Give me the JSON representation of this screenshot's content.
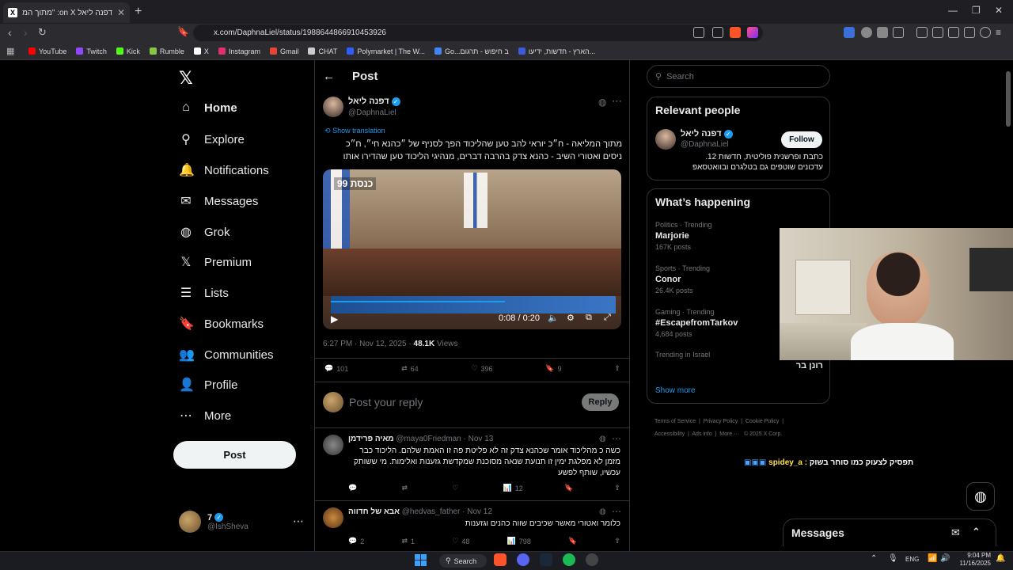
{
  "browser": {
    "tab_title": "דפנה ליאל on X: \"מתוך המלי",
    "tab_icon": "X",
    "url": "x.com/DaphnaLiel/status/1988644866910453926",
    "bookmarks": [
      {
        "label": "YouTube",
        "color": "#ff0000"
      },
      {
        "label": "Twitch",
        "color": "#9146ff"
      },
      {
        "label": "Kick",
        "color": "#53fc18"
      },
      {
        "label": "Rumble",
        "color": "#85c742"
      },
      {
        "label": "X",
        "color": "#ffffff"
      },
      {
        "label": "Instagram",
        "color": "#e1306c"
      },
      {
        "label": "Gmail",
        "color": "#ea4335"
      },
      {
        "label": "CHAT",
        "color": "#cccccc"
      },
      {
        "label": "Polymarket | The W...",
        "color": "#2e5cff"
      },
      {
        "label": "Go...ב חיפוש - תרגום",
        "color": "#4285f4"
      },
      {
        "label": "הארץ - חדשות, ידיעו...",
        "color": "#3b5bdb"
      }
    ]
  },
  "sidebar": {
    "logo": "𝕏",
    "items": [
      {
        "label": "Home",
        "icon": "⌂"
      },
      {
        "label": "Explore",
        "icon": "⚲"
      },
      {
        "label": "Notifications",
        "icon": "🔔"
      },
      {
        "label": "Messages",
        "icon": "✉"
      },
      {
        "label": "Grok",
        "icon": "◍"
      },
      {
        "label": "Premium",
        "icon": "𝕏"
      },
      {
        "label": "Lists",
        "icon": "☰"
      },
      {
        "label": "Bookmarks",
        "icon": "🔖"
      },
      {
        "label": "Communities",
        "icon": "👥"
      },
      {
        "label": "Profile",
        "icon": "👤"
      },
      {
        "label": "More",
        "icon": "⋯"
      }
    ],
    "post_button": "Post",
    "account": {
      "name": "7",
      "handle": "@IshSheva"
    }
  },
  "main": {
    "header": "Post",
    "author": {
      "name": "דפנה ליאל",
      "handle": "@DaphnaLiel"
    },
    "show_translation": "Show translation",
    "tweet_text": "מתוך המליאה - ח״כ יוראי להב טען שהליכוד הפך לסניף של ״כהנא חי״, ח״כ ניסים ואטורי השיב - כהנא צדק בהרבה דברים, מנהיגי  הליכוד טען שהדירו אותו",
    "video": {
      "time": "0:08 / 0:20",
      "overlay_logo": "כנסת 99"
    },
    "timestamp": "6:27 PM · Nov 12, 2025",
    "views_count": "48.1K",
    "views_label": "Views",
    "stats": {
      "replies": "101",
      "reposts": "64",
      "likes": "396",
      "bookmarks": "9"
    },
    "reply_placeholder": "Post your reply",
    "reply_button": "Reply",
    "replies": [
      {
        "name": "מאיה פרידמן",
        "handle": "@maya0Friedman",
        "date": "Nov 13",
        "text": "כשה כ מהליכוד אומר שכהנא צדק  זה לא פליטת פה  זו האמת שלהם. הליכוד כבר מזמן לא מפלגת ימין  זו תנועת שנאה מסוכנת שמקדשת גזענות ואלימות. מי ששותק עכשיו, שותף לפשע",
        "views": "12",
        "replies": "",
        "reposts": "",
        "likes": ""
      },
      {
        "name": "אבא של חדווה",
        "handle": "@hedvas_father",
        "date": "Nov 12",
        "text": "כלומר ואטורי מאשר שכיבים שווה כהנים וגזענות",
        "views": "798",
        "replies": "2",
        "reposts": "1",
        "likes": "48"
      }
    ]
  },
  "right": {
    "search_placeholder": "Search",
    "relevant_title": "Relevant people",
    "relevant_person": {
      "name": "דפנה ליאל",
      "handle": "@DaphnaLiel",
      "bio": "כתבת ופרשנית פוליטית, חדשות 12. עדכונים שוטפים גם בטלגרם ובוואטסאפ",
      "follow": "Follow"
    },
    "happening_title": "What’s happening",
    "trends": [
      {
        "meta": "Politics · Trending",
        "name": "Marjorie",
        "count": "167K posts"
      },
      {
        "meta": "Sports · Trending",
        "name": "Conor",
        "count": "26.4K posts"
      },
      {
        "meta": "Gaming · Trending",
        "name": "#EscapefromTarkov",
        "count": "4,684 posts"
      },
      {
        "meta": "Trending in Israel",
        "name": "רונן בר",
        "count": ""
      }
    ],
    "show_more": "Show more",
    "footer": [
      "Terms of Service",
      "Privacy Policy",
      "Cookie Policy",
      "Accessibility",
      "Ads info",
      "More ···",
      "© 2025 X Corp."
    ],
    "chat_overlay": {
      "user": "spidey_a",
      "text": "תפסיק לצעוק כמו סוחר בשוק"
    },
    "messages_label": "Messages"
  },
  "taskbar": {
    "search": "Search",
    "lang": "ENG",
    "time": "9:04 PM",
    "date": "11/16/2025"
  }
}
